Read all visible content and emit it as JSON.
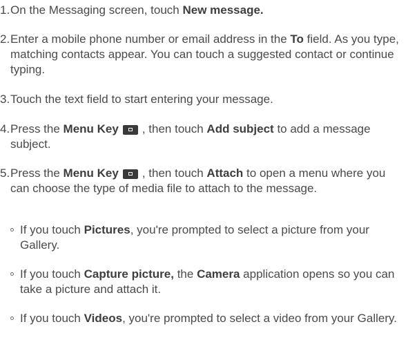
{
  "steps": [
    {
      "num": "1.",
      "t1": "On the Messaging screen, touch ",
      "b1": "New message."
    },
    {
      "num": "2.",
      "t1": "Enter a mobile phone number or email address in the ",
      "b1": "To",
      "t2": "field. As you type, matching contacts appear. You can touch a suggested contact or continue typing."
    },
    {
      "num": "3.",
      "t1": "Touch the text field to start entering your message."
    },
    {
      "num": "4.",
      "t1": "Press the ",
      "b1": "Menu Key",
      "t2": ", then touch ",
      "b2": "Add subject",
      "t3": " to add a message subject."
    },
    {
      "num": "5.",
      "t1": "Press the ",
      "b1": "Menu Key",
      "t2": ", then touch ",
      "b2": "Attach",
      "t3": " to open a menu where you can choose the type of media file to attach to the message."
    }
  ],
  "bullets": [
    {
      "t1": "If you touch ",
      "b1": "Pictures",
      "t2": ", you're prompted to select a picture from your Gallery."
    },
    {
      "t1": "If you touch ",
      "b1": "Capture picture,",
      "t2": " the ",
      "b2": "Camera",
      "t3": " application opens so you can take a picture and attach it."
    },
    {
      "t1": "If you touch ",
      "b1": "Videos",
      "t2": ", you're prompted to select a video from your Gallery."
    }
  ],
  "icons": {
    "menu_key": "menu-key-icon"
  },
  "colors": {
    "text": "#4a4a4a",
    "bold": "#3e3e3e",
    "key_icon": "#3a3a3a"
  }
}
